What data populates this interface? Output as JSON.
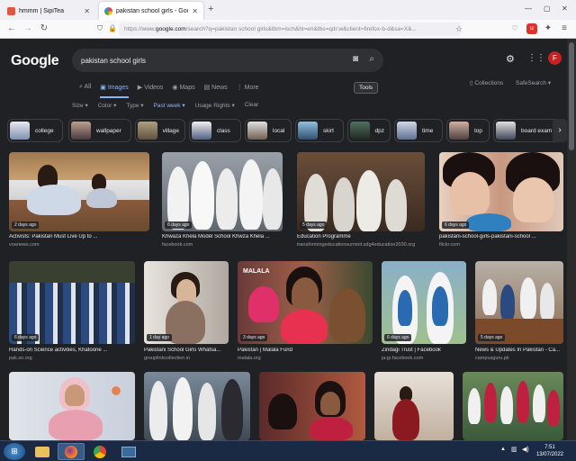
{
  "browser": {
    "tabs": [
      {
        "title": "hmmm | SipiTea",
        "active": false
      },
      {
        "title": "pakistan school girls - Google S",
        "active": true
      }
    ],
    "new_tab": "+",
    "url_prefix": "https://www.",
    "url_host": "google.com",
    "url_path": "/search?q=pakistan school girls&tbm=isch&hl=en&tbs=qdr:w&client=firefox-b-d&sa=X&..."
  },
  "google": {
    "logo": "Google",
    "query": "pakistan school girls",
    "avatar_letter": "F",
    "tabs": [
      "All",
      "Images",
      "Videos",
      "Maps",
      "News",
      "More"
    ],
    "active_tab": "Images",
    "tools": "Tools",
    "collections": "Collections",
    "safesearch": "SafeSearch",
    "filters": [
      "Size",
      "Color",
      "Type",
      "Past week",
      "Usage Rights",
      "Clear"
    ],
    "active_filter": "Past week"
  },
  "chips": [
    "college",
    "wallpaper",
    "village",
    "class",
    "local",
    "skirt",
    "dpz",
    "time",
    "top",
    "board exam"
  ],
  "results": [
    {
      "badge": "2 days ago",
      "title": "Activists: Pakistan Must Live Up to ...",
      "source": "voanews.com"
    },
    {
      "badge": "6 days ago",
      "title": "Khwaza Khela Model School Khwza Khela ...",
      "source": "facebook.com"
    },
    {
      "badge": "5 days ago",
      "title": "Education Programme",
      "source": "transformingeducationsummit.sdg4education2030.org"
    },
    {
      "badge": "6 days ago",
      "title": "pakistani-school-girls-pakistani-school ...",
      "source": "flickr.com"
    },
    {
      "badge": "6 days ago",
      "title": "Hands-on Science activities, Khatoone ...",
      "source": "pak.so.org"
    },
    {
      "badge": "1 day ago",
      "title": "Pakistani School Girls Whatsa...",
      "source": "grouplinkcollection.in"
    },
    {
      "badge": "3 days ago",
      "title": "Pakistan | Malala Fund",
      "source": "malala.org"
    },
    {
      "badge": "6 days ago",
      "title": "Zindagi Trust | Facebook",
      "source": "ja-jp.facebook.com"
    },
    {
      "badge": "5 days ago",
      "title": "News & Updates In Pakistan - Ca...",
      "source": "campusguru.pk"
    },
    {
      "badge": "",
      "title": "",
      "source": ""
    },
    {
      "badge": "",
      "title": "",
      "source": ""
    },
    {
      "badge": "",
      "title": "",
      "source": ""
    },
    {
      "badge": "",
      "title": "",
      "source": ""
    },
    {
      "badge": "",
      "title": "",
      "source": ""
    }
  ],
  "watermark_text": "MALALA",
  "taskbar": {
    "time": "7:51",
    "date": "13/07/2022"
  },
  "colors": {
    "accent": "#8ab4f8",
    "page_bg": "#202124",
    "avatar": "#c5221f"
  }
}
